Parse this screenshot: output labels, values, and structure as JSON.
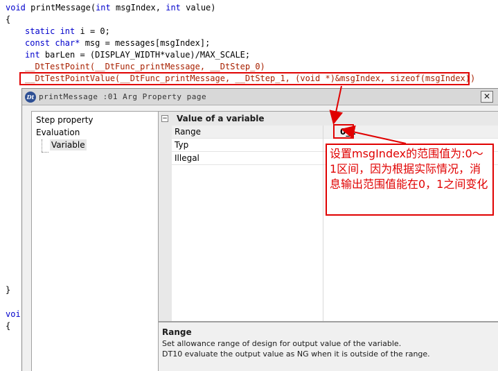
{
  "code": {
    "line1": {
      "kw": "void",
      "rest": " printMessage(",
      "kw2": "int",
      "mid": " msgIndex, ",
      "kw3": "int",
      "end": " value)"
    },
    "line2": "{",
    "line3": {
      "kw": "static",
      "tp": " int",
      "rest": " i = 0;"
    },
    "line4": {
      "kw": "const",
      "tp": " char*",
      "rest": " msg = messages[msgIndex];"
    },
    "line5": {
      "tp": "int",
      "rest": " barLen = (DISPLAY_WIDTH*value)/MAX_SCALE;"
    },
    "line6": "__DtTestPoint(__DtFunc_printMessage, __DtStep_0)",
    "line7": "__DtTestPointValue(__DtFunc_printMessage, __DtStep_1, (void *)&msgIndex, sizeof(msgIndex))",
    "close_brace": "}",
    "next_kw": "voi",
    "next_brace": "{"
  },
  "dialog": {
    "icon_text": "Dt",
    "title": "printMessage :01 Arg Property page",
    "close_symbol": "✕",
    "tree": {
      "items": [
        "Step property",
        "Evaluation"
      ],
      "child": "Variable"
    },
    "grid": {
      "category": "Value of a variable",
      "rows": [
        {
          "name": "Range",
          "value": "0_1"
        },
        {
          "name": "Typ",
          "value": ""
        },
        {
          "name": "Illegal",
          "value": ""
        }
      ]
    },
    "help": {
      "title": "Range",
      "line1": "Set allowance range of design for output value of the variable.",
      "line2": "DT10 evaluate the output value as NG when it is outside of the range."
    }
  },
  "annotation": {
    "text": "设置msgIndex的范围值为:0～1区间，因为根据实际情况，消息输出范围值能在0，1之间变化",
    "color": "#e00000"
  }
}
